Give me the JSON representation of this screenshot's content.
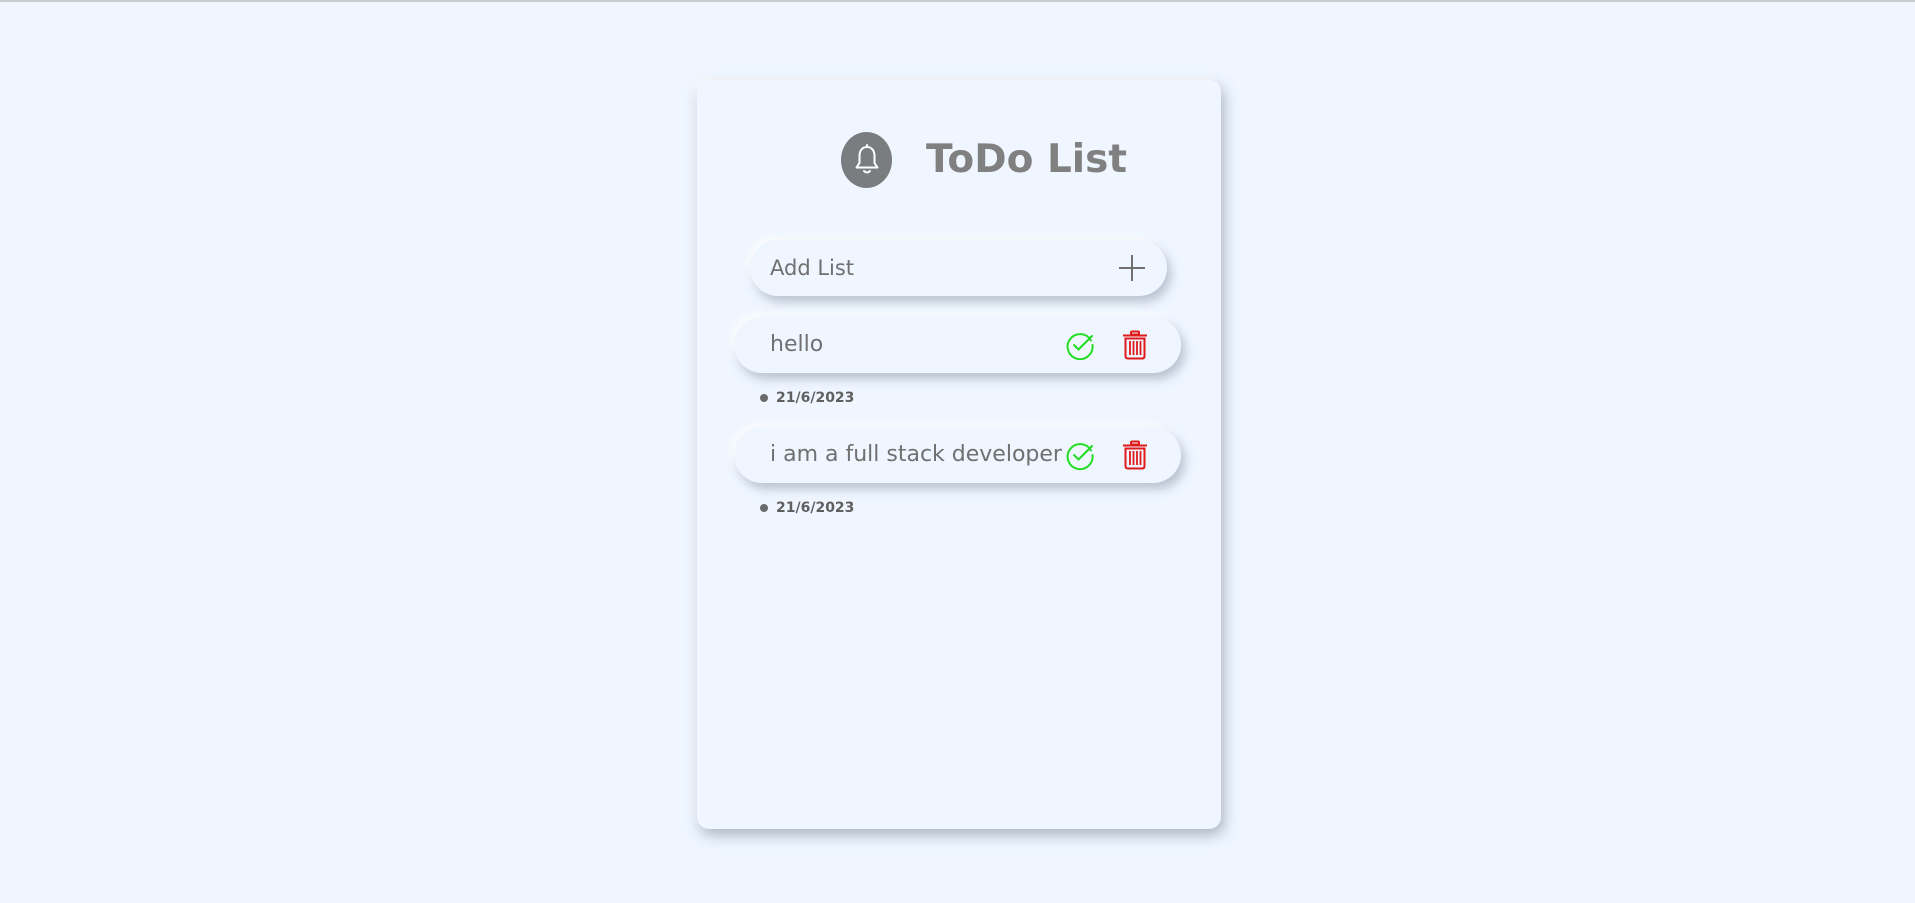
{
  "app": {
    "title": "ToDo List",
    "header_icon": "bell-icon"
  },
  "add_form": {
    "placeholder": "Add List",
    "add_icon": "plus-icon"
  },
  "todos": [
    {
      "text": "hello",
      "date": "21/6/2023",
      "complete_icon": "check-circle-icon",
      "delete_icon": "trash-icon"
    },
    {
      "text": "i am a full stack developer",
      "date": "21/6/2023",
      "complete_icon": "check-circle-icon",
      "delete_icon": "trash-icon"
    }
  ],
  "colors": {
    "background": "#eff6ff",
    "title": "#808080",
    "bell_badge": "#7a7d80",
    "check": "#22dd22",
    "trash": "#e01b1b"
  }
}
